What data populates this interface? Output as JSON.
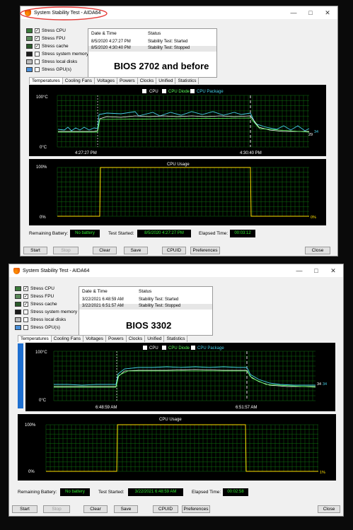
{
  "windows": [
    {
      "title": "System Stability Test - AIDA64",
      "checks": [
        {
          "label": "Stress CPU",
          "checked": true,
          "icon": "cpu-icon"
        },
        {
          "label": "Stress FPU",
          "checked": true,
          "icon": "fpu-icon"
        },
        {
          "label": "Stress cache",
          "checked": true,
          "icon": "cache-icon"
        },
        {
          "label": "Stress system memory",
          "checked": false,
          "icon": "memory-icon"
        },
        {
          "label": "Stress local disks",
          "checked": false,
          "icon": "disk-icon"
        },
        {
          "label": "Stress GPU(s)",
          "checked": false,
          "icon": "monitor-icon"
        }
      ],
      "log": {
        "col_date": "Date & Time",
        "col_status": "Status",
        "rows": [
          {
            "date": "8/5/2020 4:27:27 PM",
            "status": "Stability Test: Started"
          },
          {
            "date": "8/5/2020 4:30:40 PM",
            "status": "Stability Test: Stopped"
          }
        ]
      },
      "bios": "BIOS 2702 and before",
      "tabs": [
        "Temperatures",
        "Cooling Fans",
        "Voltages",
        "Powers",
        "Clocks",
        "Unified",
        "Statistics"
      ],
      "temp_chart": {
        "legend": [
          "CPU",
          "CPU Diode",
          "CPU Package"
        ],
        "ymax_label": "100°C",
        "ymin_label": "0°C",
        "start_time": "4:27:27 PM",
        "stop_time": "4:30:40 PM",
        "end_values": [
          "29",
          "34"
        ]
      },
      "usage_chart": {
        "title": "CPU Usage",
        "ymax_label": "100%",
        "ymin_label": "0%",
        "end_value": "0%"
      },
      "status": {
        "battery_label": "Remaining Battery:",
        "battery_value": "No battery",
        "started_label": "Test Started:",
        "started_value": "8/5/2020 4:27:27 PM",
        "elapsed_label": "Elapsed Time:",
        "elapsed_value": "00:03:12"
      },
      "buttons": {
        "start": "Start",
        "stop": "Stop",
        "clear": "Clear",
        "save": "Save",
        "cpuid": "CPUID",
        "preferences": "Preferences",
        "close": "Close"
      },
      "colors": {
        "annotation_circle": "#e53935"
      }
    },
    {
      "title": "System Stability Test - AIDA64",
      "checks": [
        {
          "label": "Stress CPU",
          "checked": true,
          "icon": "cpu-icon"
        },
        {
          "label": "Stress FPU",
          "checked": true,
          "icon": "fpu-icon"
        },
        {
          "label": "Stress cache",
          "checked": true,
          "icon": "cache-icon"
        },
        {
          "label": "Stress system memory",
          "checked": false,
          "icon": "memory-icon"
        },
        {
          "label": "Stress local disks",
          "checked": false,
          "icon": "disk-icon"
        },
        {
          "label": "Stress GPU(s)",
          "checked": false,
          "icon": "monitor-icon"
        }
      ],
      "log": {
        "col_date": "Date & Time",
        "col_status": "Status",
        "rows": [
          {
            "date": "3/22/2021 6:48:59 AM",
            "status": "Stability Test: Started"
          },
          {
            "date": "3/22/2021 6:51:57 AM",
            "status": "Stability Test: Stopped"
          }
        ]
      },
      "bios": "BIOS 3302",
      "tabs": [
        "Temperatures",
        "Cooling Fans",
        "Voltages",
        "Powers",
        "Clocks",
        "Unified",
        "Statistics"
      ],
      "temp_chart": {
        "legend": [
          "CPU",
          "CPU Diode",
          "CPU Package"
        ],
        "ymax_label": "100°C",
        "ymin_label": "0°C",
        "start_time": "6:48:59 AM",
        "stop_time": "6:51:57 AM",
        "end_values": [
          "34",
          "34"
        ]
      },
      "usage_chart": {
        "title": "CPU Usage",
        "ymax_label": "100%",
        "ymin_label": "0%",
        "end_value": "1%"
      },
      "status": {
        "battery_label": "Remaining Battery:",
        "battery_value": "No battery",
        "started_label": "Test Started:",
        "started_value": "3/22/2021 6:48:59 AM",
        "elapsed_label": "Elapsed Time:",
        "elapsed_value": "00:02:58"
      },
      "buttons": {
        "start": "Start",
        "stop": "Stop",
        "clear": "Clear",
        "save": "Save",
        "cpuid": "CPUID",
        "preferences": "Preferences",
        "close": "Close"
      }
    }
  ]
}
